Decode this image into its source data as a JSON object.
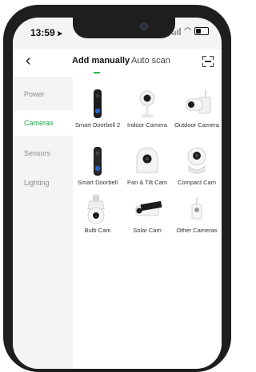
{
  "status_bar": {
    "time": "13:59"
  },
  "header": {
    "tab_active": "Add manually",
    "tab_other": "Auto scan"
  },
  "sidebar": {
    "items": [
      {
        "label": "Power",
        "active": false
      },
      {
        "label": "Cameras",
        "active": true
      },
      {
        "label": "Sensors",
        "active": false
      },
      {
        "label": "Lighting",
        "active": false
      }
    ]
  },
  "products": [
    {
      "label": "Smart Doorbell 2",
      "icon": "doorbell-2-icon"
    },
    {
      "label": "Indoor Camera",
      "icon": "indoor-camera-icon"
    },
    {
      "label": "Outdoor Camera",
      "icon": "outdoor-camera-icon"
    },
    {
      "label": "Smart Doorbell",
      "icon": "doorbell-icon"
    },
    {
      "label": "Pan & Tilt Cam",
      "icon": "pan-tilt-cam-icon"
    },
    {
      "label": "Compact Cam",
      "icon": "compact-cam-icon"
    },
    {
      "label": "Bulb Cam",
      "icon": "bulb-cam-icon"
    },
    {
      "label": "Solar Cam",
      "icon": "solar-cam-icon"
    },
    {
      "label": "Other Cameras",
      "icon": "other-cameras-icon"
    }
  ],
  "colors": {
    "accent": "#22a34a"
  }
}
